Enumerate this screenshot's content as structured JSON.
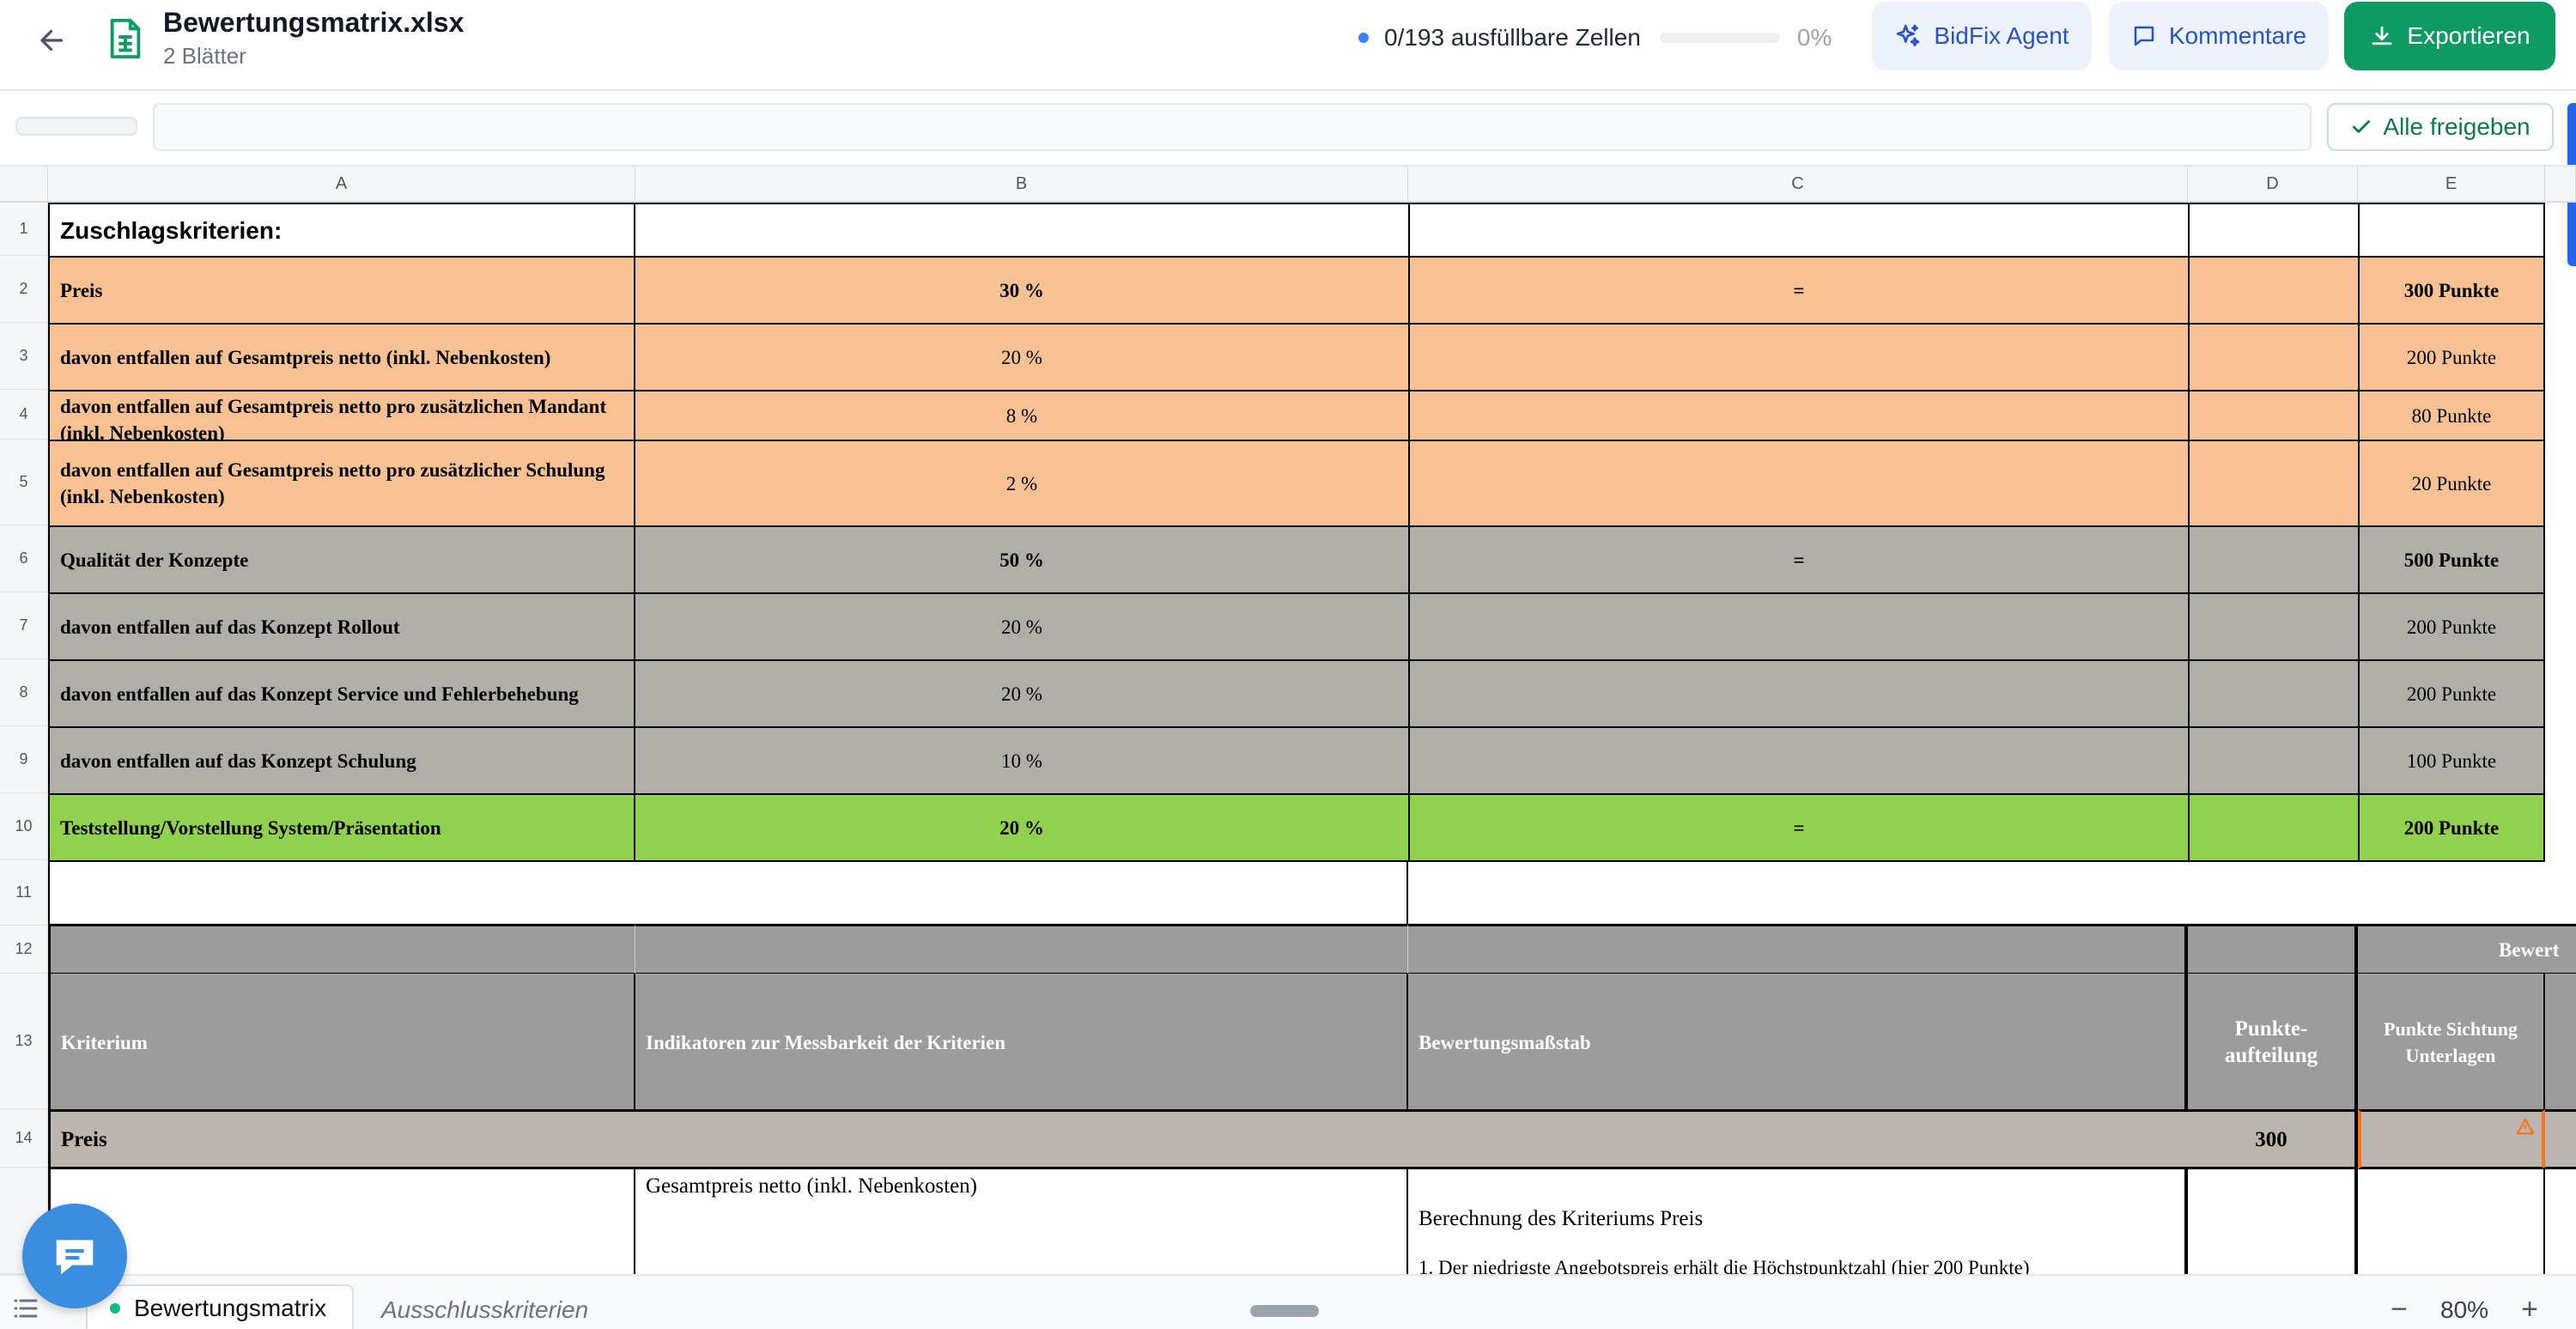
{
  "header": {
    "file_name": "Bewertungsmatrix.xlsx",
    "sheet_count": "2 Blätter",
    "progress_text": "0/193 ausfüllbare Zellen",
    "progress_fraction": 0,
    "progress_percent": "0%",
    "agent_label": "BidFix Agent",
    "comments_label": "Kommentare",
    "export_label": "Exportieren",
    "accent_color": "#0d9a63"
  },
  "toolbar": {
    "approve_all_label": "Alle freigeben"
  },
  "columns": [
    "A",
    "B",
    "C",
    "D",
    "E"
  ],
  "rows": [
    "1",
    "2",
    "3",
    "4",
    "5",
    "6",
    "7",
    "8",
    "9",
    "10",
    "11",
    "12",
    "13",
    "14"
  ],
  "sheet": {
    "r1": {
      "a": "Zuschlagskriterien:"
    },
    "r2": {
      "a": "Preis",
      "b": "30 %",
      "c": "=",
      "e": "300 Punkte"
    },
    "r3": {
      "a": "davon entfallen auf Gesamtpreis netto (inkl. Nebenkosten)",
      "b": "20 %",
      "e": "200 Punkte"
    },
    "r4": {
      "a": "davon entfallen auf Gesamtpreis netto pro zusätzlichen Mandant (inkl. Nebenkosten)",
      "b": "8 %",
      "e": "80 Punkte"
    },
    "r5": {
      "a": "davon entfallen auf Gesamtpreis netto pro zusätzlicher Schulung (inkl. Nebenkosten)",
      "b": "2 %",
      "e": "20 Punkte"
    },
    "r6": {
      "a": "Qualität der Konzepte",
      "b": "50 %",
      "c": "=",
      "e": "500 Punkte"
    },
    "r7": {
      "a": "davon entfallen auf das Konzept Rollout",
      "b": "20 %",
      "e": "200 Punkte"
    },
    "r8": {
      "a": "davon entfallen auf das Konzept Service und Fehlerbehebung",
      "b": "20 %",
      "e": "200 Punkte"
    },
    "r9": {
      "a": "davon entfallen auf das Konzept Schulung",
      "b": "10 %",
      "e": "100 Punkte"
    },
    "r10": {
      "a": "Teststellung/Vorstellung System/Präsentation",
      "b": "20 %",
      "c": "=",
      "e": "200 Punkte"
    },
    "r12": {
      "e": "Bewert"
    },
    "r13": {
      "a": "Kriterium",
      "b": "Indikatoren zur Messbarkeit der Kriterien",
      "c": "Bewertungsmaßstab",
      "d": "Punkte-aufteilung",
      "e": "Punkte Sichtung Unterlagen"
    },
    "r14": {
      "a": "Preis",
      "d": "300"
    },
    "r15": {
      "b": "Gesamtpreis netto (inkl. Nebenkosten)",
      "c": "Berechnung des Kriteriums Preis",
      "c2": "1. Der niedrigste Angebotspreis erhält die Höchstpunktzahl (hier 200 Punkte)"
    }
  },
  "colors": {
    "price_rows": "#f8c193",
    "quality_rows": "#b1aeaa",
    "test_row": "#91d150",
    "header_rows": "#9c9c9c",
    "warning": "#f97316"
  },
  "tabs": {
    "active": "Bewertungsmatrix",
    "other": "Ausschlusskriterien"
  },
  "zoom": {
    "minus": "−",
    "value": "80%",
    "plus": "+"
  }
}
